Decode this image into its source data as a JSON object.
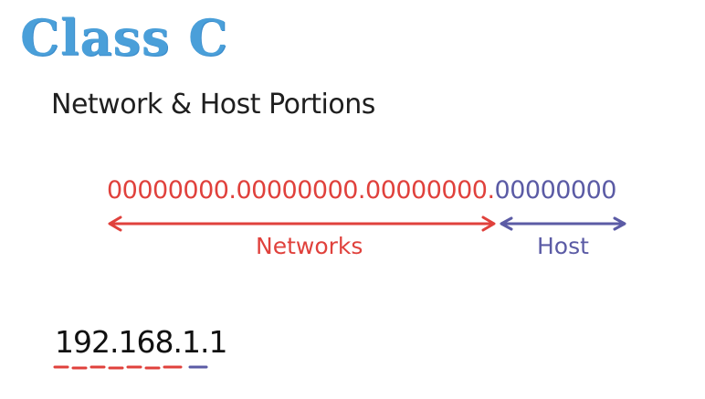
{
  "title": "Class C",
  "subtitle": "Network & Host Portions",
  "binary": {
    "network_part": "00000000.00000000.00000000.",
    "host_part": "00000000"
  },
  "labels": {
    "network": "Networks",
    "host": "Host"
  },
  "example_ip": "192.168.1.1",
  "colors": {
    "title": "#4a9fd9",
    "network": "#e0413c",
    "host": "#5b5ba5",
    "text": "#1f1f1f"
  }
}
